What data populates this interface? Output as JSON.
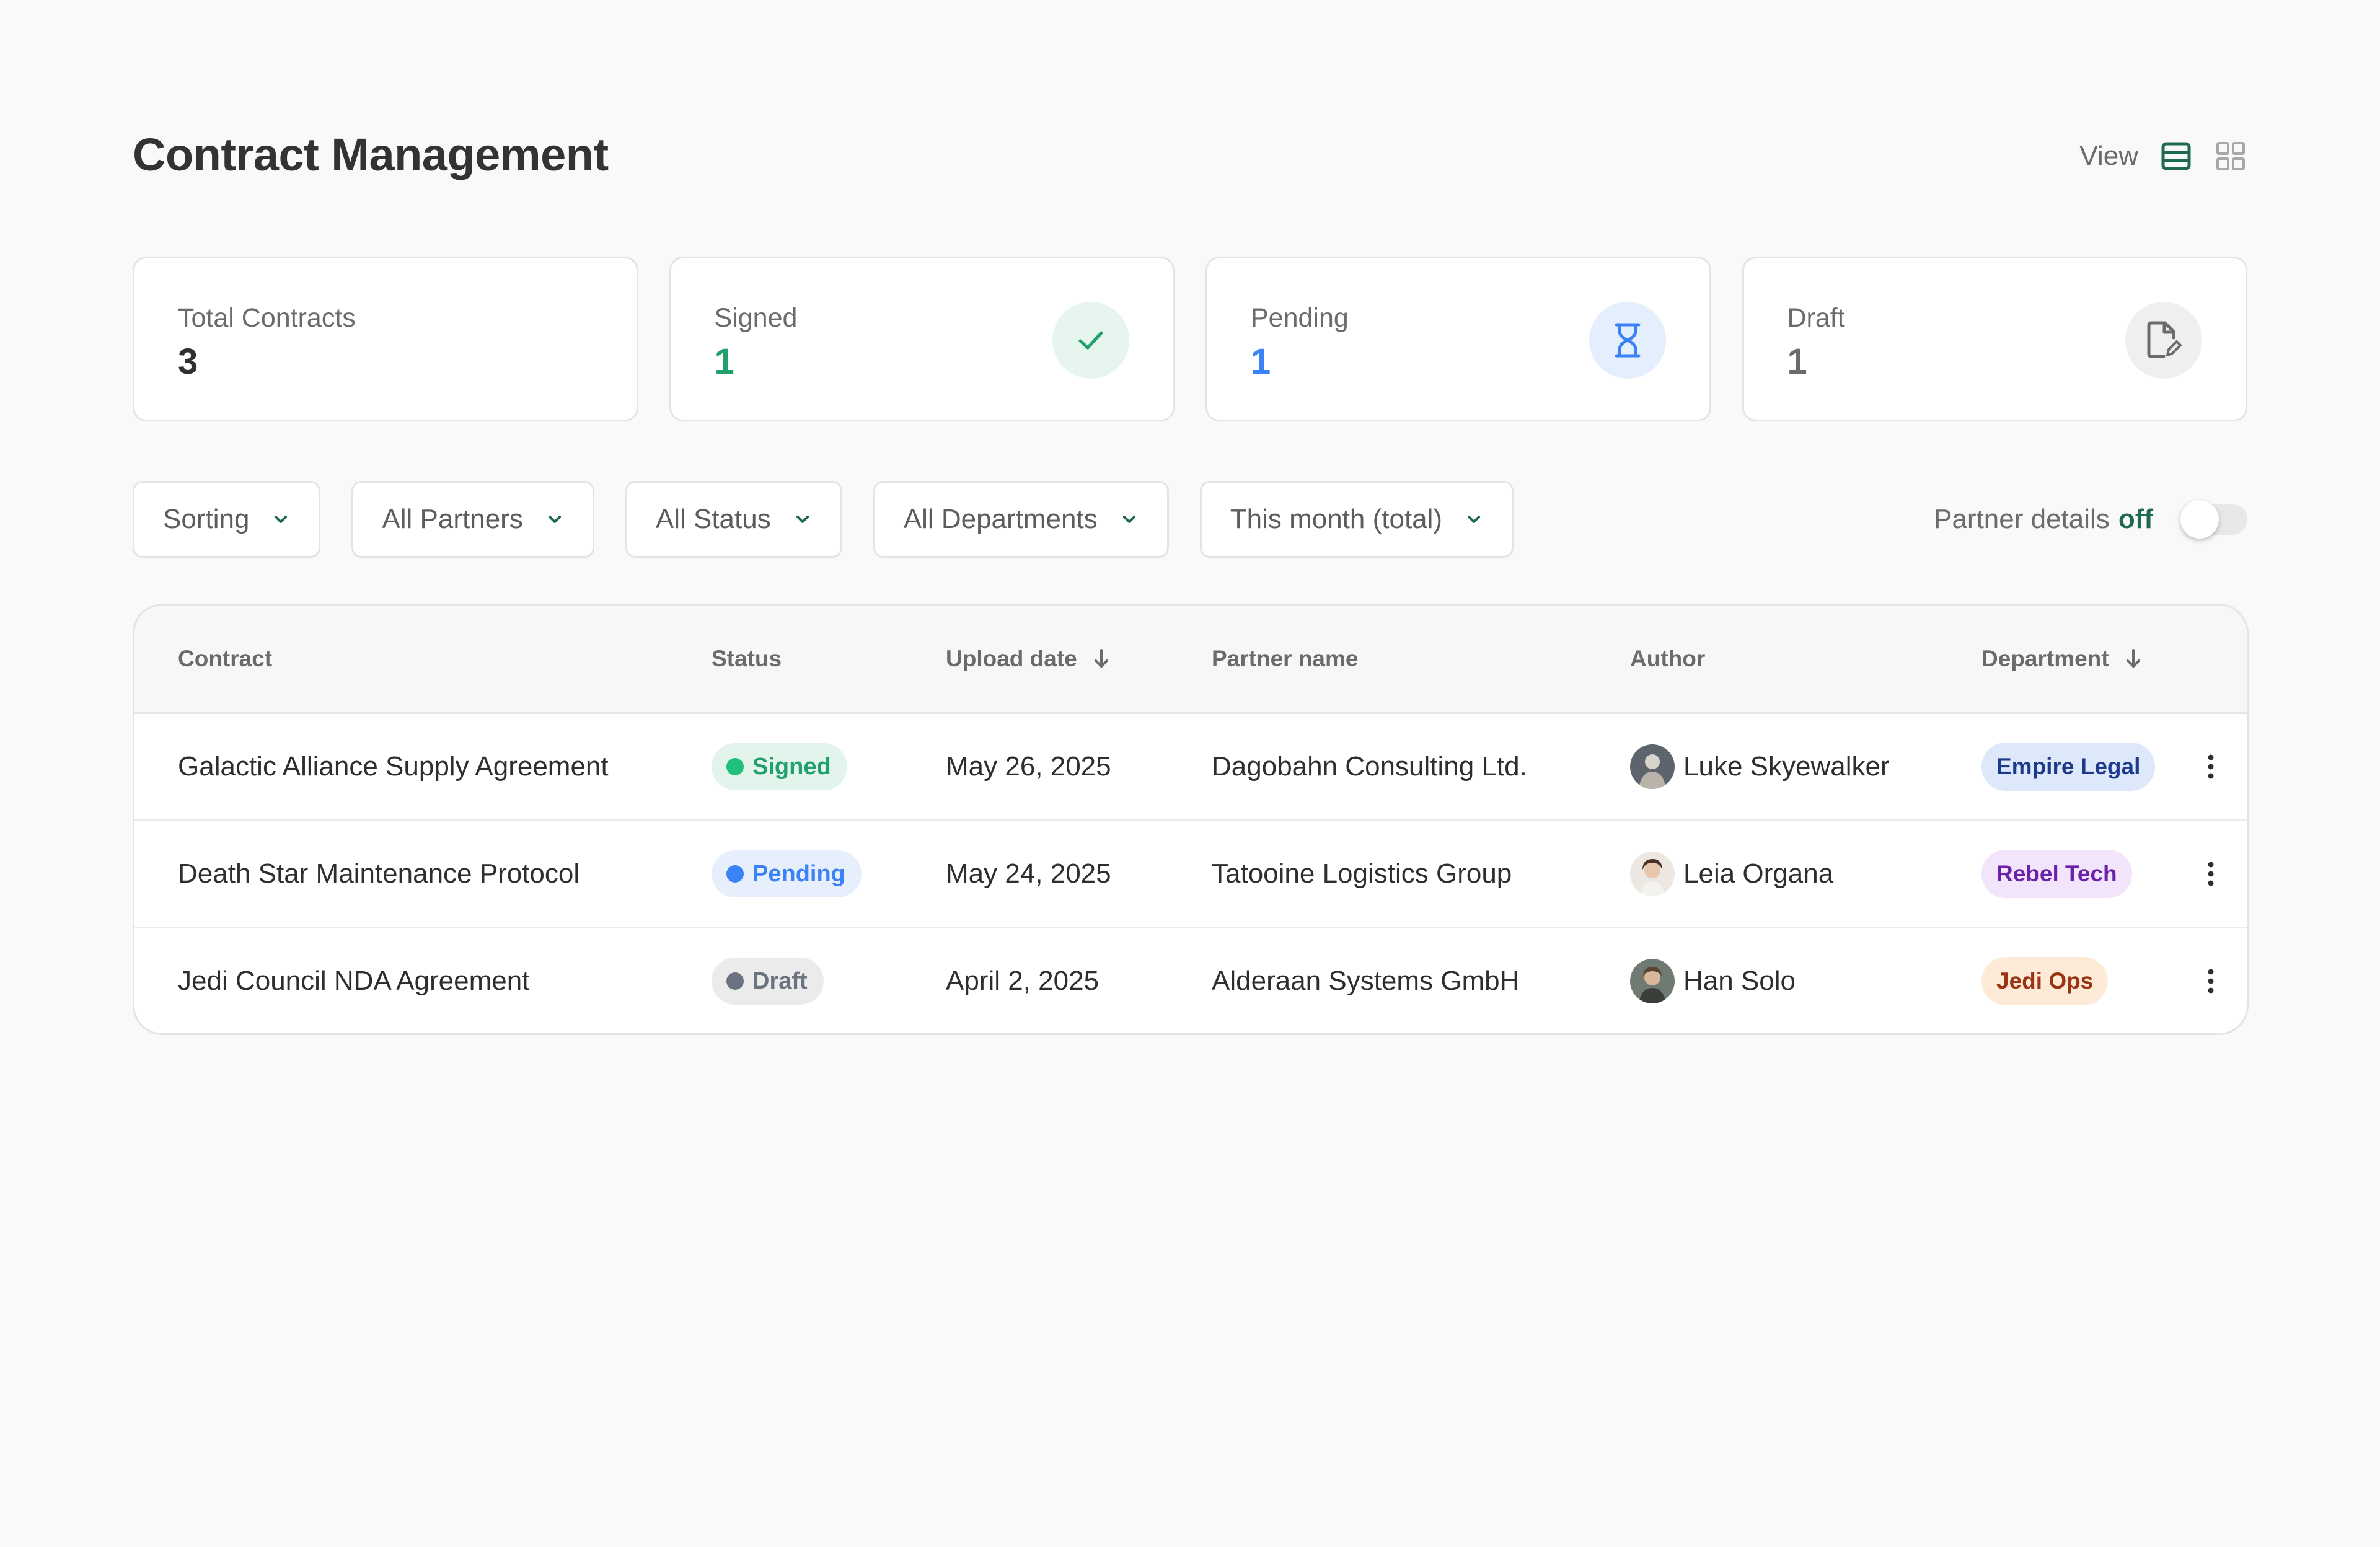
{
  "header": {
    "title": "Contract Management",
    "view_label": "View"
  },
  "stats": [
    {
      "label": "Total Contracts",
      "value": "3",
      "color": "#2f2f2f"
    },
    {
      "label": "Signed",
      "value": "1",
      "color": "#22a06b",
      "icon": "check-icon"
    },
    {
      "label": "Pending",
      "value": "1",
      "color": "#3b82f6",
      "icon": "hourglass-icon"
    },
    {
      "label": "Draft",
      "value": "1",
      "color": "#6b6b6b",
      "icon": "document-edit-icon"
    }
  ],
  "filters": {
    "sorting": "Sorting",
    "partners": "All Partners",
    "status": "All Status",
    "departments": "All Departments",
    "period": "This month (total)"
  },
  "partner_toggle": {
    "label": "Partner details",
    "state": "off"
  },
  "table": {
    "columns": {
      "contract": "Contract",
      "status": "Status",
      "upload_date": "Upload date",
      "partner": "Partner name",
      "author": "Author",
      "department": "Department"
    },
    "rows": [
      {
        "contract": "Galactic Alliance Supply Agreement",
        "status": "Signed",
        "upload_date": "May 26, 2025",
        "partner": "Dagobahn Consulting Ltd.",
        "author": "Luke Skyewalker",
        "department": "Empire Legal"
      },
      {
        "contract": "Death Star Maintenance Protocol",
        "status": "Pending",
        "upload_date": "May 24, 2025",
        "partner": "Tatooine Logistics Group",
        "author": "Leia Organa",
        "department": "Rebel Tech"
      },
      {
        "contract": "Jedi Council NDA Agreement",
        "status": "Draft",
        "upload_date": "April 2, 2025",
        "partner": "Alderaan Systems GmbH",
        "author": "Han Solo",
        "department": "Jedi Ops"
      }
    ]
  },
  "colors": {
    "accent": "#1d6a4d",
    "signed": "#22a06b",
    "pending": "#3b82f6",
    "draft": "#6b7280",
    "dept_empire_legal": "#1e3a8a",
    "dept_rebel_tech": "#6b21a8",
    "dept_jedi_ops": "#9a3412"
  }
}
